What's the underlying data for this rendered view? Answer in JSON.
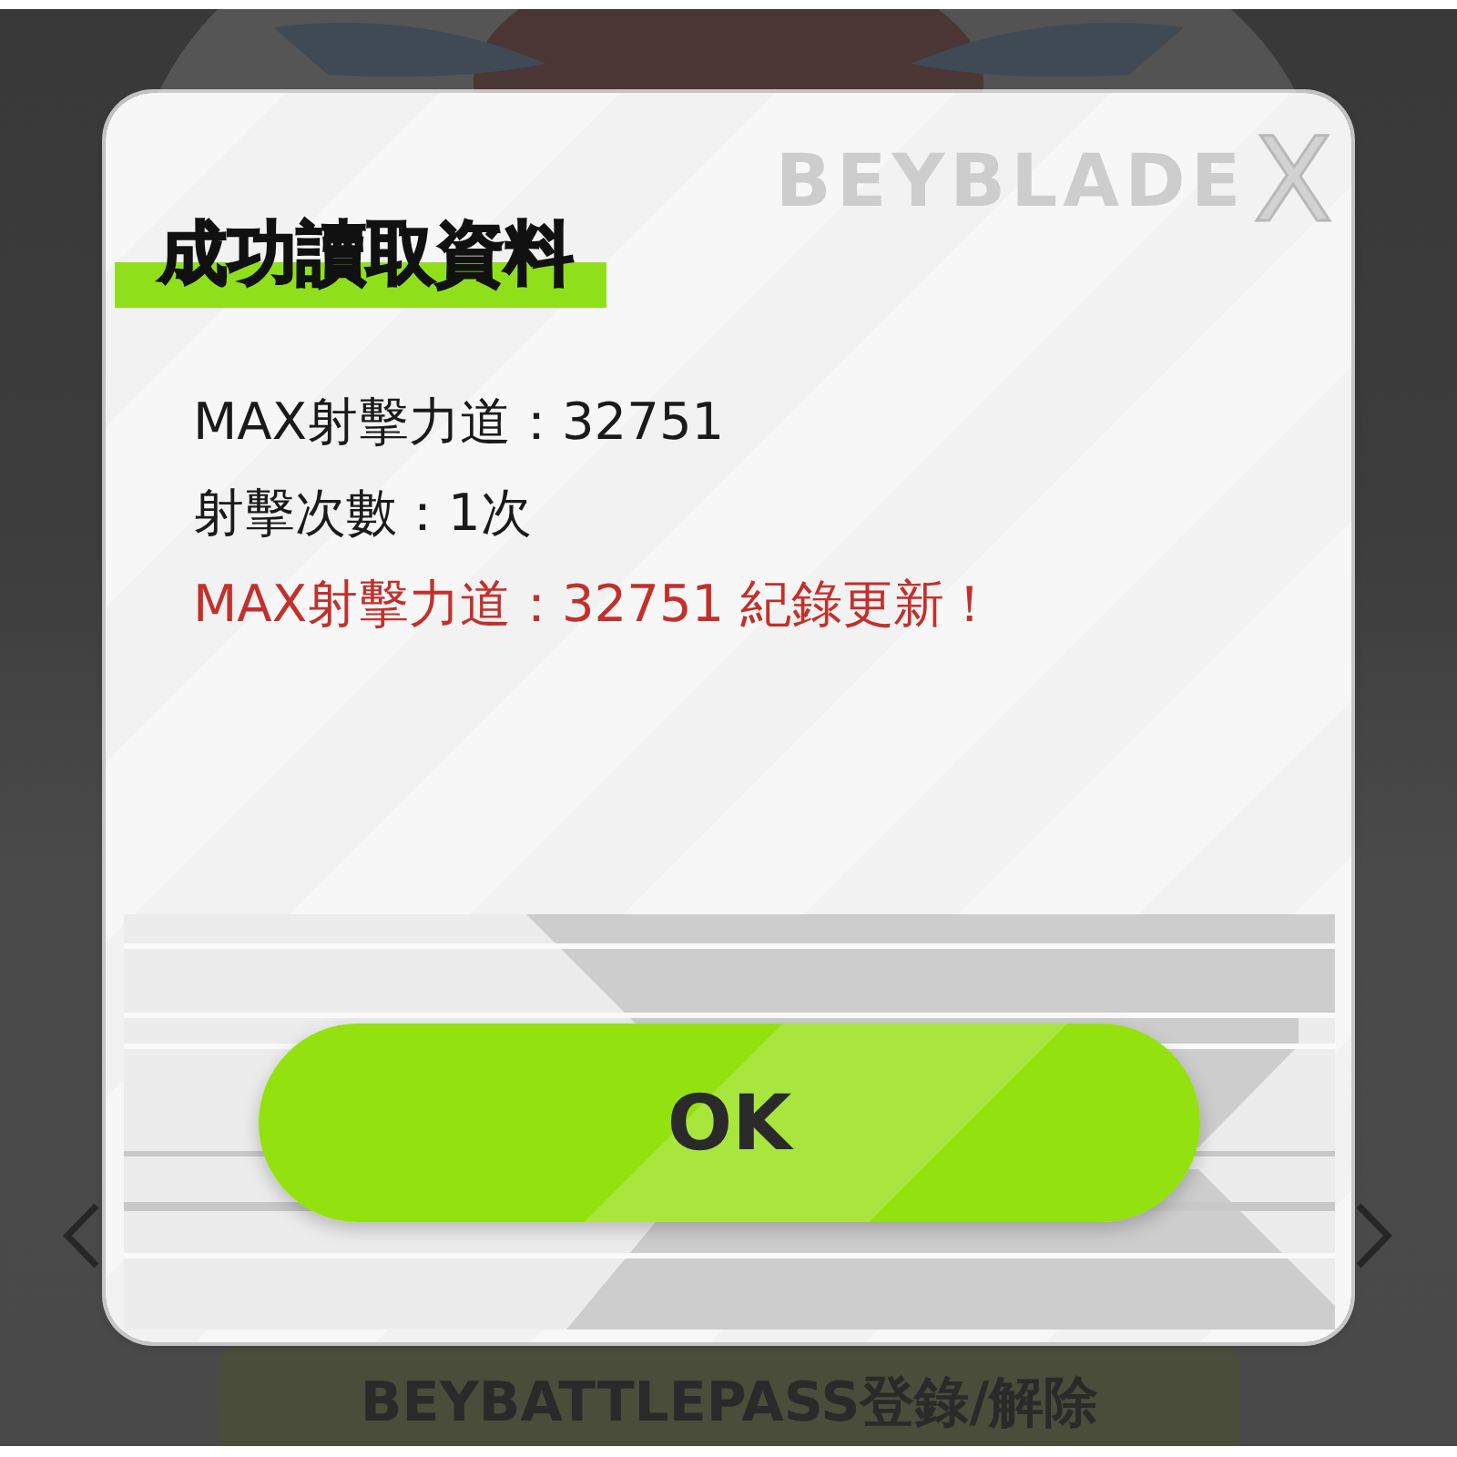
{
  "dialog": {
    "logo": {
      "text": "BEYBLADE",
      "mark": "X"
    },
    "title": "成功讀取資料",
    "lines": [
      {
        "text": "MAX射擊力道：32751",
        "kind": "normal"
      },
      {
        "text": "射擊次數：1次",
        "kind": "normal"
      },
      {
        "text": "MAX射擊力道：32751 紀錄更新！",
        "kind": "highlight"
      }
    ],
    "button": "OK"
  },
  "background": {
    "button": "BEYBATTLEPASS登錄/解除"
  }
}
